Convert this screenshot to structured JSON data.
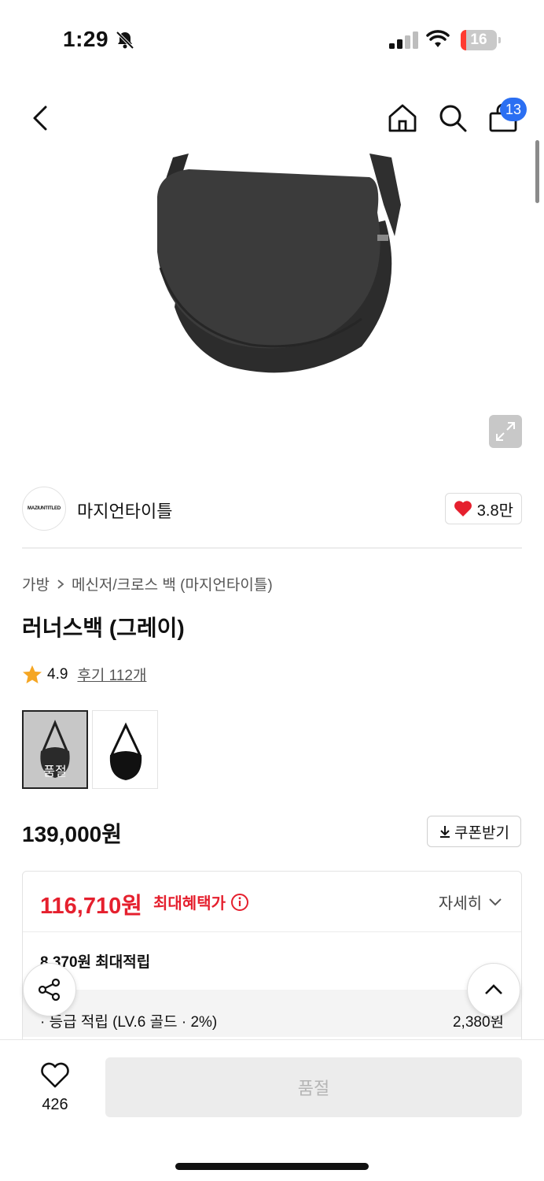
{
  "status_bar": {
    "time": "1:29",
    "battery_level": "16",
    "battery_fraction": 0.16,
    "battery_color": "#ff3b30"
  },
  "nav": {
    "cart_badge": "13",
    "badge_color": "#2b6ff2"
  },
  "brand": {
    "logo_text": "MAZIUNTITLED",
    "name": "마지언타이틀",
    "likes": "3.8만"
  },
  "breadcrumb": {
    "category": "가방",
    "subcategory": "메신저/크로스 백 (마지언타이틀)"
  },
  "product": {
    "title": "러너스백 (그레이)",
    "rating": "4.9",
    "review_text": "후기 112개"
  },
  "thumbnails": {
    "soldout_label": "품절"
  },
  "pricing": {
    "price": "139,000원",
    "coupon_label": "쿠폰받기",
    "max_benefit_price": "116,710원",
    "max_benefit_label": "최대혜택가",
    "detail_label": "자세히",
    "max_points": "8,370원 최대적립",
    "grade_label": "· 등급 적립 (LV.6 골드 · 2%)",
    "grade_value": "2,380원",
    "accent_color": "#e5202e"
  },
  "bottom": {
    "wish_count": "426",
    "buy_label": "품절"
  }
}
